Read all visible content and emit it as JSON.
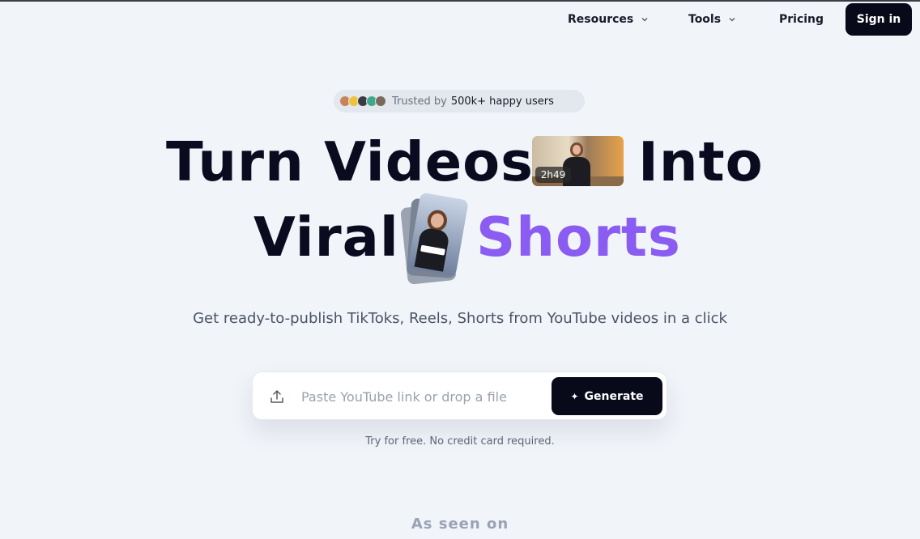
{
  "nav": {
    "resources_label": "Resources",
    "tools_label": "Tools",
    "pricing_label": "Pricing",
    "signin_label": "Sign in"
  },
  "trusted": {
    "prefix": "Trusted by",
    "highlight": "500k+ happy users",
    "avatar_colors": [
      "#c9835a",
      "#f0c23a",
      "#3a3a44",
      "#3ea88c",
      "#7a6a5a"
    ]
  },
  "headline": {
    "line1_word1": "Turn Videos",
    "line1_word2": "Into",
    "line2_word1": "Viral",
    "line2_word2": "Shorts",
    "accent_color": "#8a5cf2",
    "video_badge": "2h49"
  },
  "subtitle": "Get ready-to-publish TikToks, Reels, Shorts from YouTube videos in a click",
  "input": {
    "placeholder": "Paste YouTube link or drop a file",
    "value": "",
    "upload_icon": "upload-icon",
    "generate_label": "Generate",
    "generate_icon": "sparkle-icon"
  },
  "free_note": "Try for free. No credit card required.",
  "as_seen_on": "As seen on"
}
